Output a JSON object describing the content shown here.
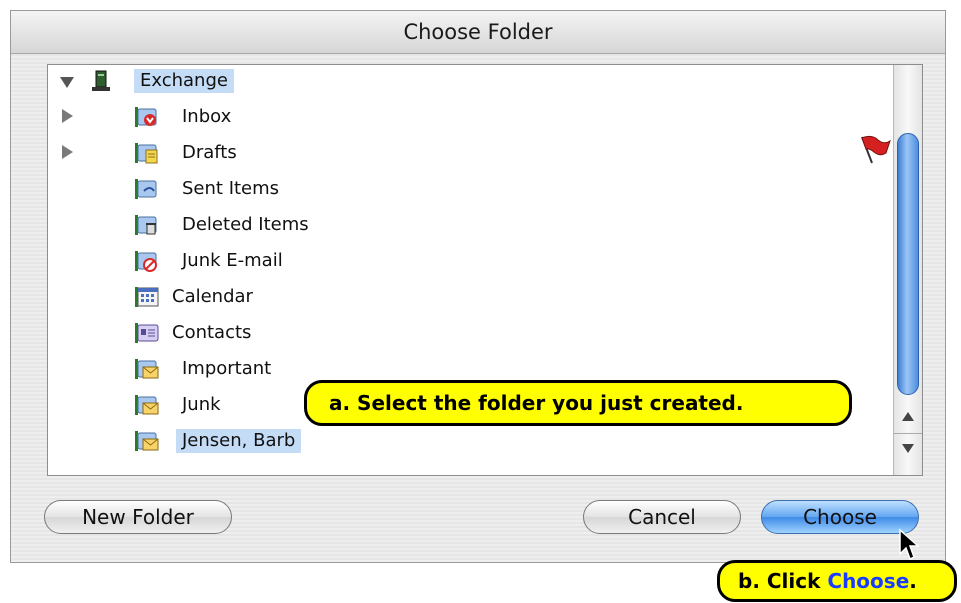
{
  "dialog": {
    "title": "Choose Folder"
  },
  "folders": [
    {
      "label": "Exchange",
      "icon": "exchange-server-icon",
      "expanded": true,
      "selected": true
    },
    {
      "label": "Inbox",
      "icon": "inbox-folder-icon",
      "collapsed": true
    },
    {
      "label": "Drafts",
      "icon": "drafts-folder-icon",
      "collapsed": true
    },
    {
      "label": "Sent Items",
      "icon": "sent-items-folder-icon"
    },
    {
      "label": "Deleted Items",
      "icon": "deleted-items-folder-icon"
    },
    {
      "label": "Junk E-mail",
      "icon": "junk-email-folder-icon"
    },
    {
      "label": "Calendar",
      "icon": "calendar-folder-icon"
    },
    {
      "label": "Contacts",
      "icon": "contacts-folder-icon"
    },
    {
      "label": "Important",
      "icon": "mail-folder-icon"
    },
    {
      "label": "Junk",
      "icon": "mail-folder-icon"
    },
    {
      "label": "Jensen, Barb",
      "icon": "mail-folder-icon",
      "selected": true
    }
  ],
  "buttons": {
    "new_folder": "New Folder",
    "cancel": "Cancel",
    "choose": "Choose"
  },
  "callouts": {
    "a": "a.  Select the folder you just created.",
    "b_prefix": "b.  Click ",
    "b_link": "Choose",
    "b_suffix": "."
  },
  "colors": {
    "selection": "#c5dcf6",
    "callout": "#ffff00",
    "primary_button": "#3f8ae6",
    "link": "#1a3cff"
  }
}
